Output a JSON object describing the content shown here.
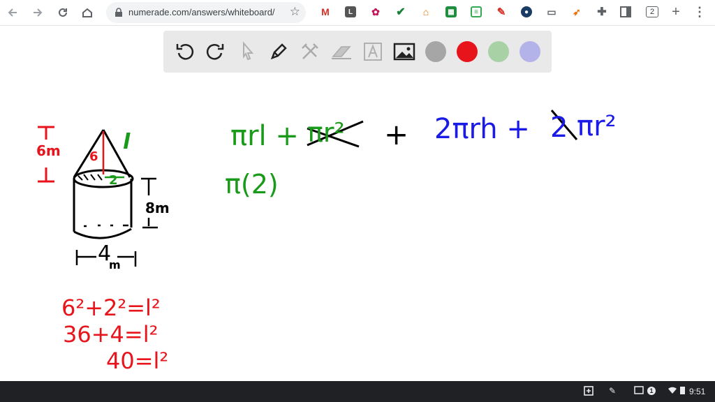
{
  "browser": {
    "url": "numerade.com/answers/whiteboard/",
    "tab_count": "2"
  },
  "toolbar": {
    "tools": [
      "undo-icon",
      "redo-icon",
      "select-arrow-icon",
      "pen-icon",
      "tools-icon",
      "eraser-icon",
      "text-icon",
      "image-icon"
    ],
    "colors": [
      "#a6a6a6",
      "#e8141b",
      "#a9d1a6",
      "#b3b3ea"
    ]
  },
  "whiteboard": {
    "cone_height": "6m",
    "slant_label": "l",
    "slant_height_value": "6",
    "radius_value": "2",
    "cylinder_height": "8m",
    "diameter": "4",
    "diameter_unit": "m",
    "formula_green": "πrl +",
    "formula_crossed": "πr²",
    "plus": "+",
    "formula_blue": "2πrh +",
    "formula_blue_crossed": "2",
    "formula_blue_end": "πr²",
    "substitution": "π(2)",
    "eq1": "6²+2²=l²",
    "eq2": "36+4=l²",
    "eq3": "40=l²"
  },
  "shelf": {
    "notification_count": "1",
    "time": "9:51"
  }
}
